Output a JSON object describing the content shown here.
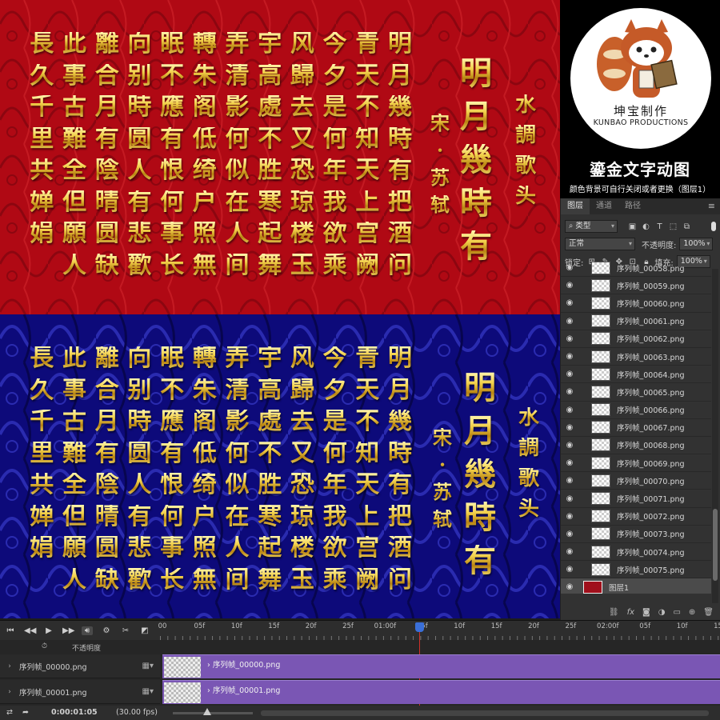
{
  "poem": {
    "title": [
      "水",
      "調",
      "歌",
      "头"
    ],
    "author": [
      "宋",
      "·",
      "苏",
      "轼"
    ],
    "headline": [
      "明",
      "月",
      "幾",
      "時",
      "有"
    ],
    "columns": [
      [
        "明",
        "月",
        "幾",
        "時",
        "有",
        "把",
        "酒",
        "问"
      ],
      [
        "青",
        "天",
        "不",
        "知",
        "天",
        "上",
        "宫",
        "阙"
      ],
      [
        "今",
        "夕",
        "是",
        "何",
        "年",
        "我",
        "欲",
        "乘"
      ],
      [
        "风",
        "歸",
        "去",
        "又",
        "恐",
        "琼",
        "楼",
        "玉"
      ],
      [
        "宇",
        "高",
        "處",
        "不",
        "胜",
        "寒",
        "起",
        "舞"
      ],
      [
        "弄",
        "清",
        "影",
        "何",
        "似",
        "在",
        "人",
        "间"
      ],
      [
        "轉",
        "朱",
        "阁",
        "低",
        "绮",
        "户",
        "照",
        "無"
      ],
      [
        "眠",
        "不",
        "應",
        "有",
        "恨",
        "何",
        "事",
        "长"
      ],
      [
        "向",
        "别",
        "時",
        "圆",
        "人",
        "有",
        "悲",
        "歡"
      ],
      [
        "離",
        "合",
        "月",
        "有",
        "陰",
        "晴",
        "圆",
        "缺"
      ],
      [
        "此",
        "事",
        "古",
        "難",
        "全",
        "但",
        "願",
        "人"
      ],
      [
        "長",
        "久",
        "千",
        "里",
        "共",
        "婵",
        "娟"
      ]
    ]
  },
  "branding": {
    "logo_cn": "坤宝制作",
    "logo_en": "KUNBAO PRODUCTIONS",
    "title": "鎏金文字动图",
    "subtitle": "颜色背景可自行关闭或者更换（图层1）"
  },
  "layers_panel": {
    "tabs": [
      "图层",
      "通道",
      "路径"
    ],
    "filter_kind": "类型",
    "blend_mode": "正常",
    "opacity_label": "不透明度:",
    "opacity_value": "100%",
    "lock_label": "锁定:",
    "fill_label": "填充:",
    "fill_value": "100%",
    "layers": [
      "序列帧_00058.png",
      "序列帧_00059.png",
      "序列帧_00060.png",
      "序列帧_00061.png",
      "序列帧_00062.png",
      "序列帧_00063.png",
      "序列帧_00064.png",
      "序列帧_00065.png",
      "序列帧_00066.png",
      "序列帧_00067.png",
      "序列帧_00068.png",
      "序列帧_00069.png",
      "序列帧_00070.png",
      "序列帧_00071.png",
      "序列帧_00072.png",
      "序列帧_00073.png",
      "序列帧_00074.png",
      "序列帧_00075.png"
    ],
    "background_layer": "图层1",
    "footer_fx": "fx"
  },
  "timeline": {
    "ruler_ticks": [
      "00",
      "05f",
      "10f",
      "15f",
      "20f",
      "25f",
      "01:00f",
      "05f",
      "10f",
      "15f",
      "20f",
      "25f",
      "02:00f",
      "05f",
      "10f",
      "15f"
    ],
    "opacity_label": "不透明度",
    "tracks": [
      {
        "name": "序列帧_00000.png",
        "clip": "序列帧_00000.png"
      },
      {
        "name": "序列帧_00001.png",
        "clip": "序列帧_00001.png"
      }
    ],
    "current_time": "0:00:01:05",
    "fps": "(30.00 fps)"
  },
  "colors": {
    "red_bg": "#b00914",
    "blue_bg": "#0d0a7a",
    "gold": "#e9c441",
    "clip": "#7a56b4",
    "playhead": "#3a6fd8"
  }
}
